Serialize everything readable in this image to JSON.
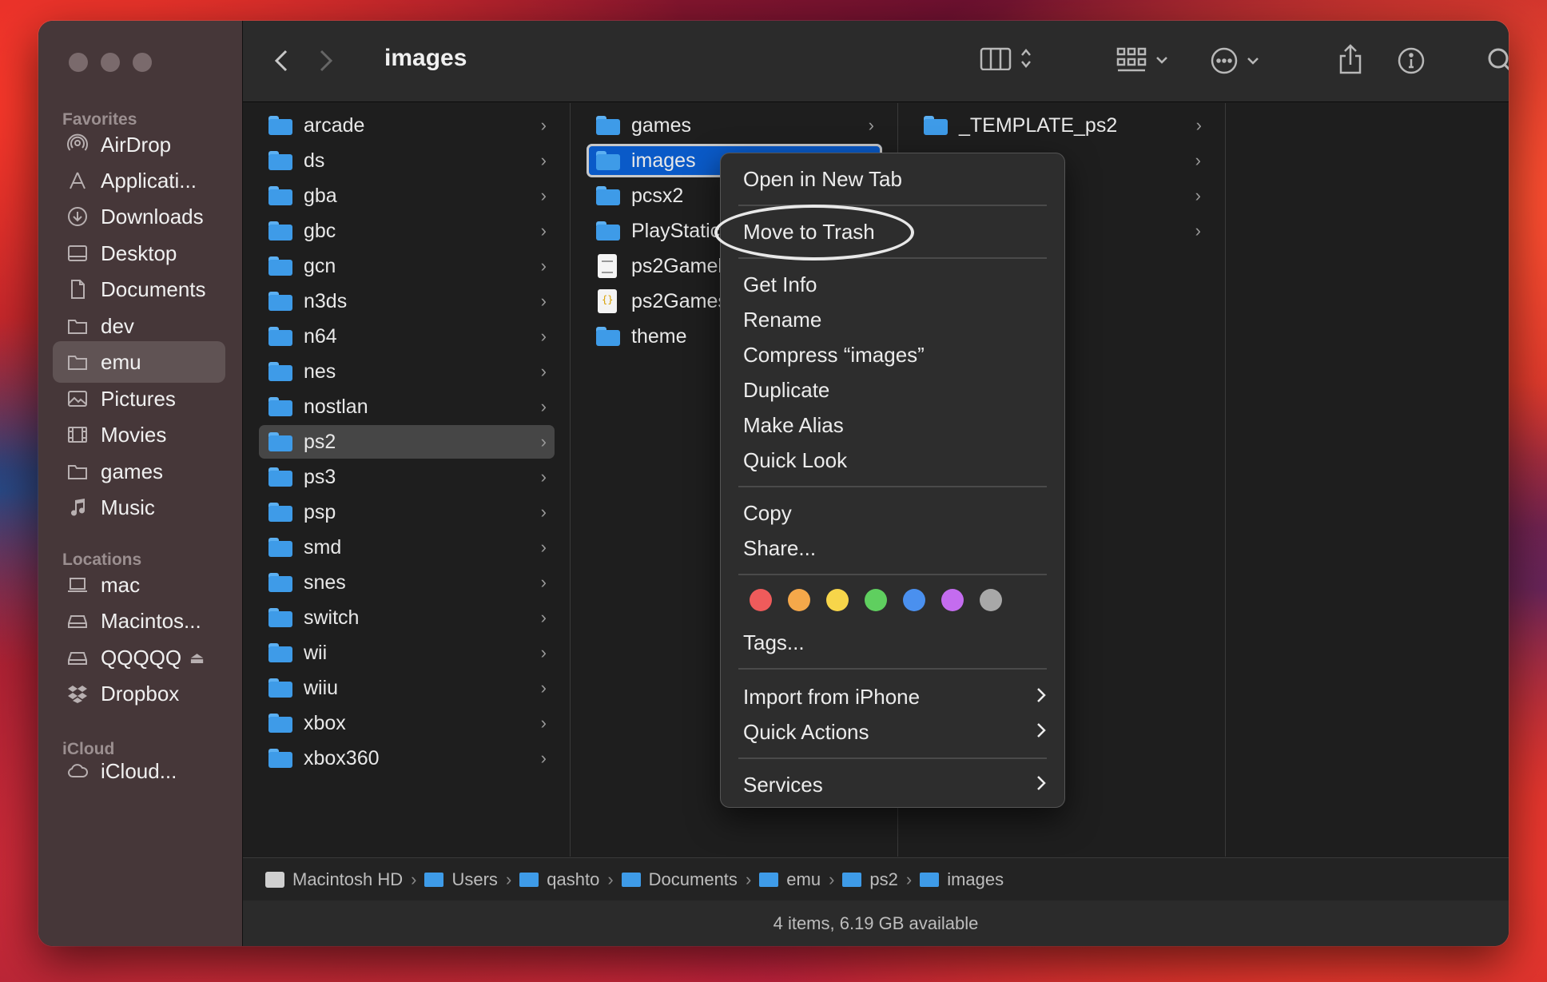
{
  "window": {
    "title": "images"
  },
  "sidebar": {
    "favorites_label": "Favorites",
    "favorites": [
      {
        "label": "AirDrop",
        "icon": "airdrop-icon"
      },
      {
        "label": "Applicati...",
        "icon": "applications-icon"
      },
      {
        "label": "Downloads",
        "icon": "downloads-icon"
      },
      {
        "label": "Desktop",
        "icon": "desktop-icon"
      },
      {
        "label": "Documents",
        "icon": "document-icon"
      },
      {
        "label": "dev",
        "icon": "folder-icon"
      },
      {
        "label": "emu",
        "icon": "folder-icon"
      },
      {
        "label": "Pictures",
        "icon": "pictures-icon"
      },
      {
        "label": "Movies",
        "icon": "movies-icon"
      },
      {
        "label": "games",
        "icon": "folder-icon"
      },
      {
        "label": "Music",
        "icon": "music-icon"
      }
    ],
    "locations_label": "Locations",
    "locations": [
      {
        "label": "mac",
        "icon": "laptop-icon"
      },
      {
        "label": "Macintos...",
        "icon": "disk-icon"
      },
      {
        "label": "QQQQQ",
        "icon": "disk-icon"
      },
      {
        "label": "Dropbox",
        "icon": "dropbox-icon"
      }
    ],
    "icloud_label": "iCloud",
    "icloud": [
      {
        "label": "iCloud...",
        "icon": "cloud-icon"
      }
    ]
  },
  "columns": {
    "col1": [
      "arcade",
      "ds",
      "gba",
      "gbc",
      "gcn",
      "n3ds",
      "n64",
      "nes",
      "nostlan",
      "ps2",
      "ps3",
      "psp",
      "smd",
      "snes",
      "switch",
      "wii",
      "wiiu",
      "xbox",
      "xbox360"
    ],
    "col2": [
      {
        "label": "games",
        "kind": "folder"
      },
      {
        "label": "images",
        "kind": "folder"
      },
      {
        "label": "pcsx2",
        "kind": "folder"
      },
      {
        "label": "PlayStatic",
        "kind": "folder"
      },
      {
        "label": "ps2Gamel",
        "kind": "txt"
      },
      {
        "label": "ps2Games",
        "kind": "json"
      },
      {
        "label": "theme",
        "kind": "folder"
      }
    ],
    "col3": [
      "_TEMPLATE_ps2"
    ]
  },
  "context_menu": {
    "items": {
      "open_new_tab": "Open in New Tab",
      "move_to_trash": "Move to Trash",
      "get_info": "Get Info",
      "rename": "Rename",
      "compress": "Compress “images”",
      "duplicate": "Duplicate",
      "make_alias": "Make Alias",
      "quick_look": "Quick Look",
      "copy": "Copy",
      "share": "Share...",
      "tags": "Tags...",
      "import_iphone": "Import from iPhone",
      "quick_actions": "Quick Actions",
      "services": "Services"
    },
    "tag_colors": [
      "#ef5b5b",
      "#f5a84a",
      "#f7d54a",
      "#5fcf5f",
      "#4a90ef",
      "#c46cef",
      "#a8a8a8"
    ]
  },
  "pathbar": [
    "Macintosh HD",
    "Users",
    "qashto",
    "Documents",
    "emu",
    "ps2",
    "images"
  ],
  "status": "4 items, 6.19 GB available"
}
